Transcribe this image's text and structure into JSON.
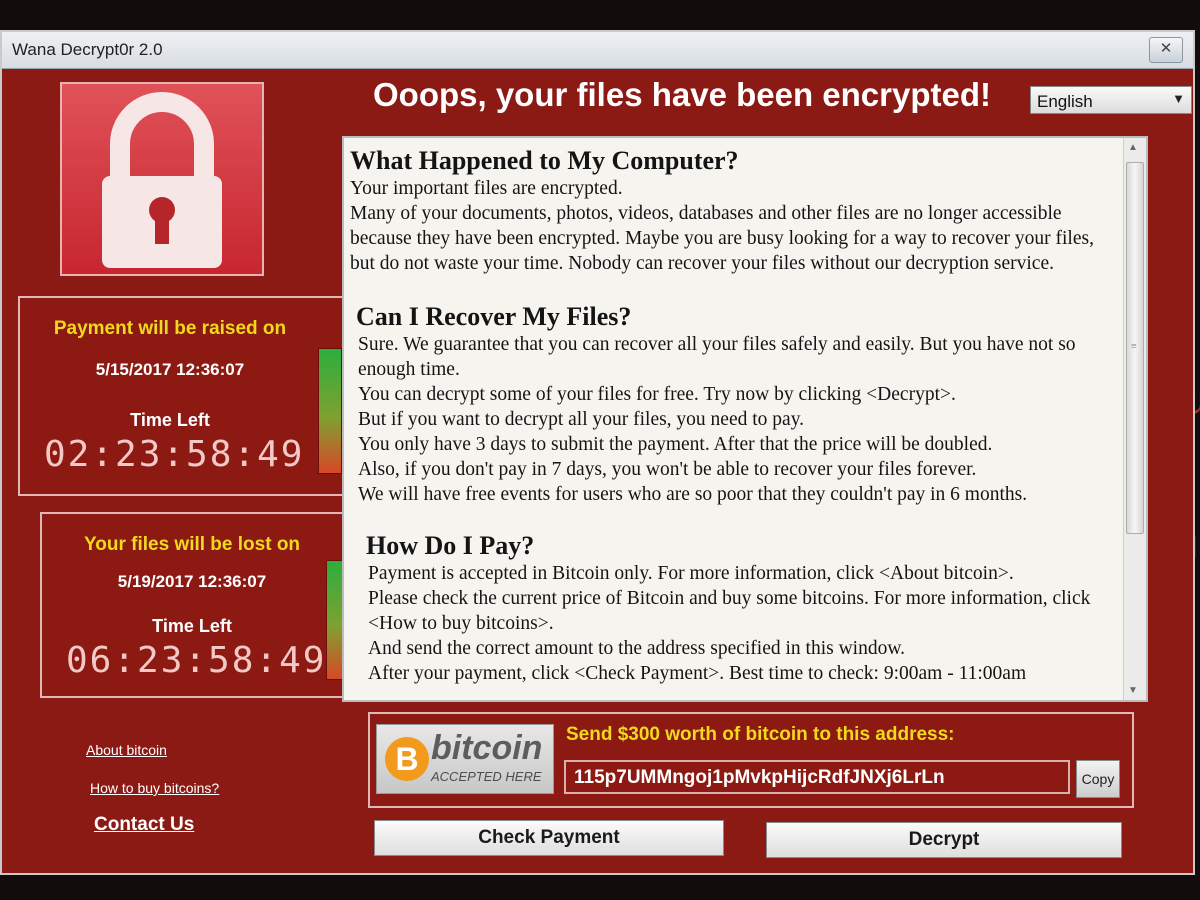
{
  "window": {
    "title": "Wana Decrypt0r 2.0",
    "close_glyph": "✕",
    "headline": "Ooops, your files have been encrypted!",
    "language": {
      "selected": "English",
      "arrow": "▼"
    }
  },
  "timers": [
    {
      "heading": "Payment will be raised on",
      "date": "5/15/2017 12:36:07",
      "time_left_label": "Time Left",
      "countdown": "02:23:58:49"
    },
    {
      "heading": "Your files will be lost on",
      "date": "5/19/2017 12:36:07",
      "time_left_label": "Time Left",
      "countdown": "06:23:58:49"
    }
  ],
  "links": {
    "about_bitcoin": "About bitcoin",
    "how_to_buy": "How to buy bitcoins?",
    "contact_us": "Contact Us"
  },
  "message": {
    "sections": [
      {
        "heading": "What Happened to My Computer?",
        "paragraphs": [
          "Your important files are encrypted.",
          "Many of your documents, photos, videos, databases and other files are no longer accessible because they have been encrypted. Maybe you are busy looking for a way to recover your files, but do not waste your time. Nobody can recover your files without our decryption service."
        ]
      },
      {
        "heading": "Can I Recover My Files?",
        "paragraphs": [
          "Sure. We guarantee that you can recover all your files safely and easily. But you have not so enough time.",
          "You can decrypt some of your files for free. Try now by clicking <Decrypt>.",
          "But if you want to decrypt all your files, you need to pay.",
          "You only have 3 days to submit the payment. After that the price will be doubled.",
          "Also, if you don't pay in 7 days, you won't be able to recover your files forever.",
          "We will have free events for users who are so poor that they couldn't pay in 6 months."
        ]
      },
      {
        "heading": "How Do I Pay?",
        "paragraphs": [
          "Payment is accepted in Bitcoin only. For more information, click <About bitcoin>.",
          "Please check the current price of Bitcoin and buy some bitcoins. For more information, click <How to buy bitcoins>.",
          "And send the correct amount to the address specified in this window.",
          "After your payment, click <Check Payment>. Best time to check: 9:00am - 11:00am"
        ]
      }
    ]
  },
  "bitcoin": {
    "coin_letter": "B",
    "logo_word": "bitcoin",
    "logo_sub": "ACCEPTED HERE",
    "send_label": "Send $300 worth of bitcoin to this address:",
    "address": "115p7UMMngoj1pMvkpHijcRdfJNXj6LrLn",
    "copy_label": "Copy"
  },
  "buttons": {
    "check_payment": "Check Payment",
    "decrypt": "Decrypt"
  },
  "colors": {
    "window_red": "#8c1a14",
    "heading_yellow": "#f1d91d",
    "bitcoin_orange": "#f19a1e"
  }
}
